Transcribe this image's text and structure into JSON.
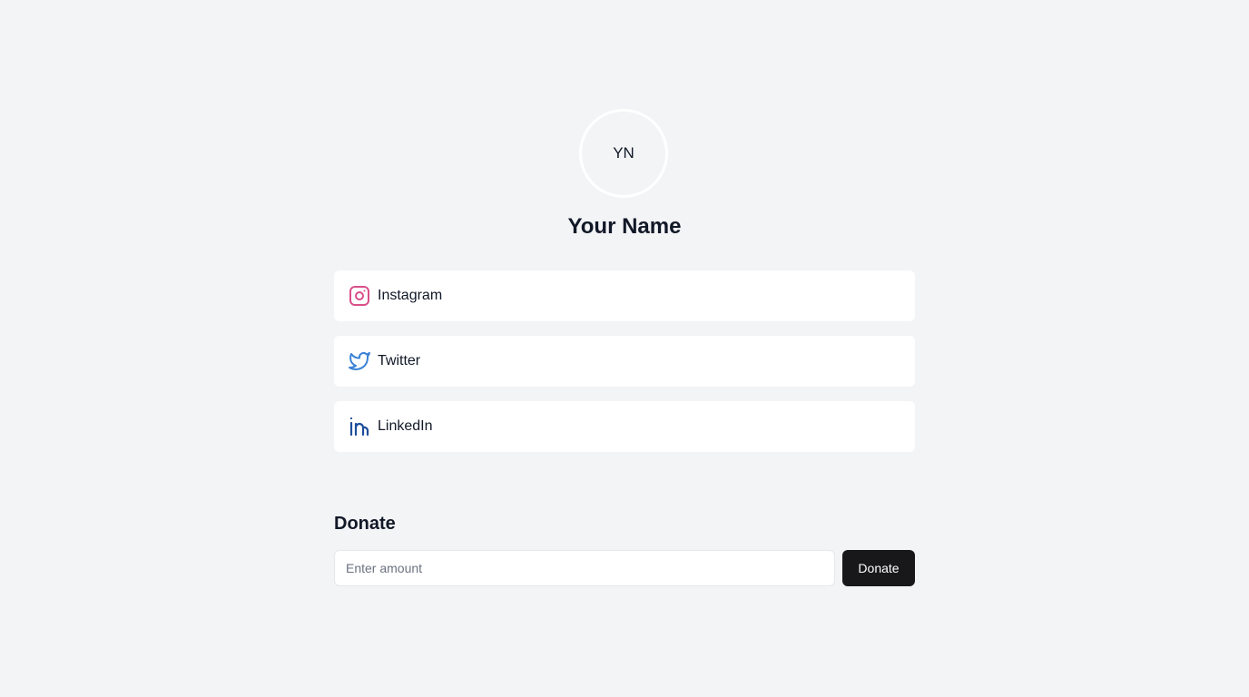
{
  "profile": {
    "initials": "YN",
    "name": "Your Name"
  },
  "links": [
    {
      "label": "Instagram",
      "icon": "instagram-icon",
      "color": "#e1306c"
    },
    {
      "label": "Twitter",
      "icon": "twitter-icon",
      "color": "#1da1f2"
    },
    {
      "label": "LinkedIn",
      "icon": "linkedin-icon",
      "color": "#0a66c2"
    }
  ],
  "donate": {
    "title": "Donate",
    "placeholder": "Enter amount",
    "value": "",
    "button_label": "Donate"
  },
  "colors": {
    "background": "#f3f4f6",
    "card": "#ffffff",
    "text": "#111827",
    "button": "#18181b"
  }
}
